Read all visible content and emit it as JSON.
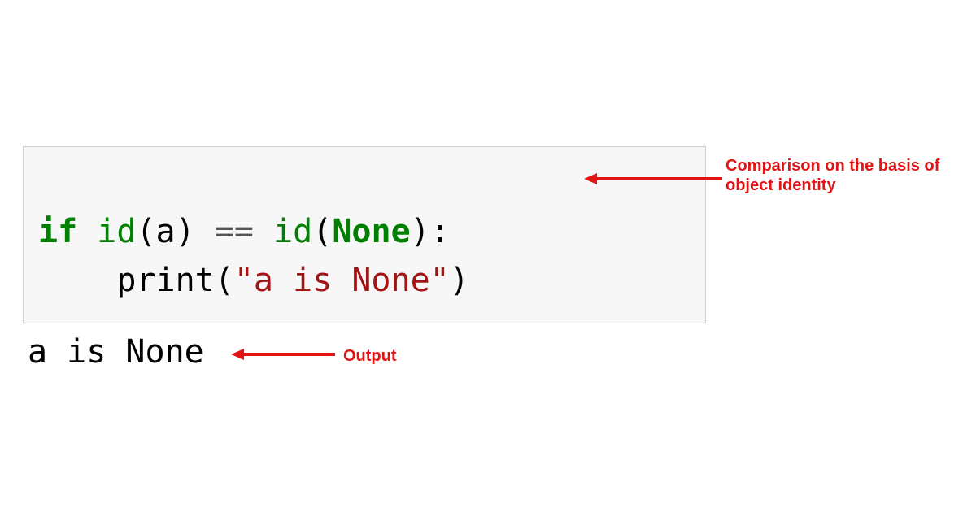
{
  "code": {
    "line1": {
      "kw_if": "if",
      "sp1": " ",
      "fn_id1": "id",
      "lp1": "(",
      "var_a": "a",
      "rp1": ")",
      "sp2": " ",
      "op_eq": "==",
      "sp3": " ",
      "fn_id2": "id",
      "lp2": "(",
      "kw_none": "None",
      "rp2": ")",
      "colon": ":"
    },
    "line2": {
      "indent": "    ",
      "fn_print": "print",
      "lp": "(",
      "str": "\"a is None\"",
      "rp": ")"
    }
  },
  "output": "a is None",
  "annotations": {
    "comparison": "Comparison on the basis of object identity",
    "output_label": "Output"
  },
  "colors": {
    "annotation": "#e31313"
  }
}
